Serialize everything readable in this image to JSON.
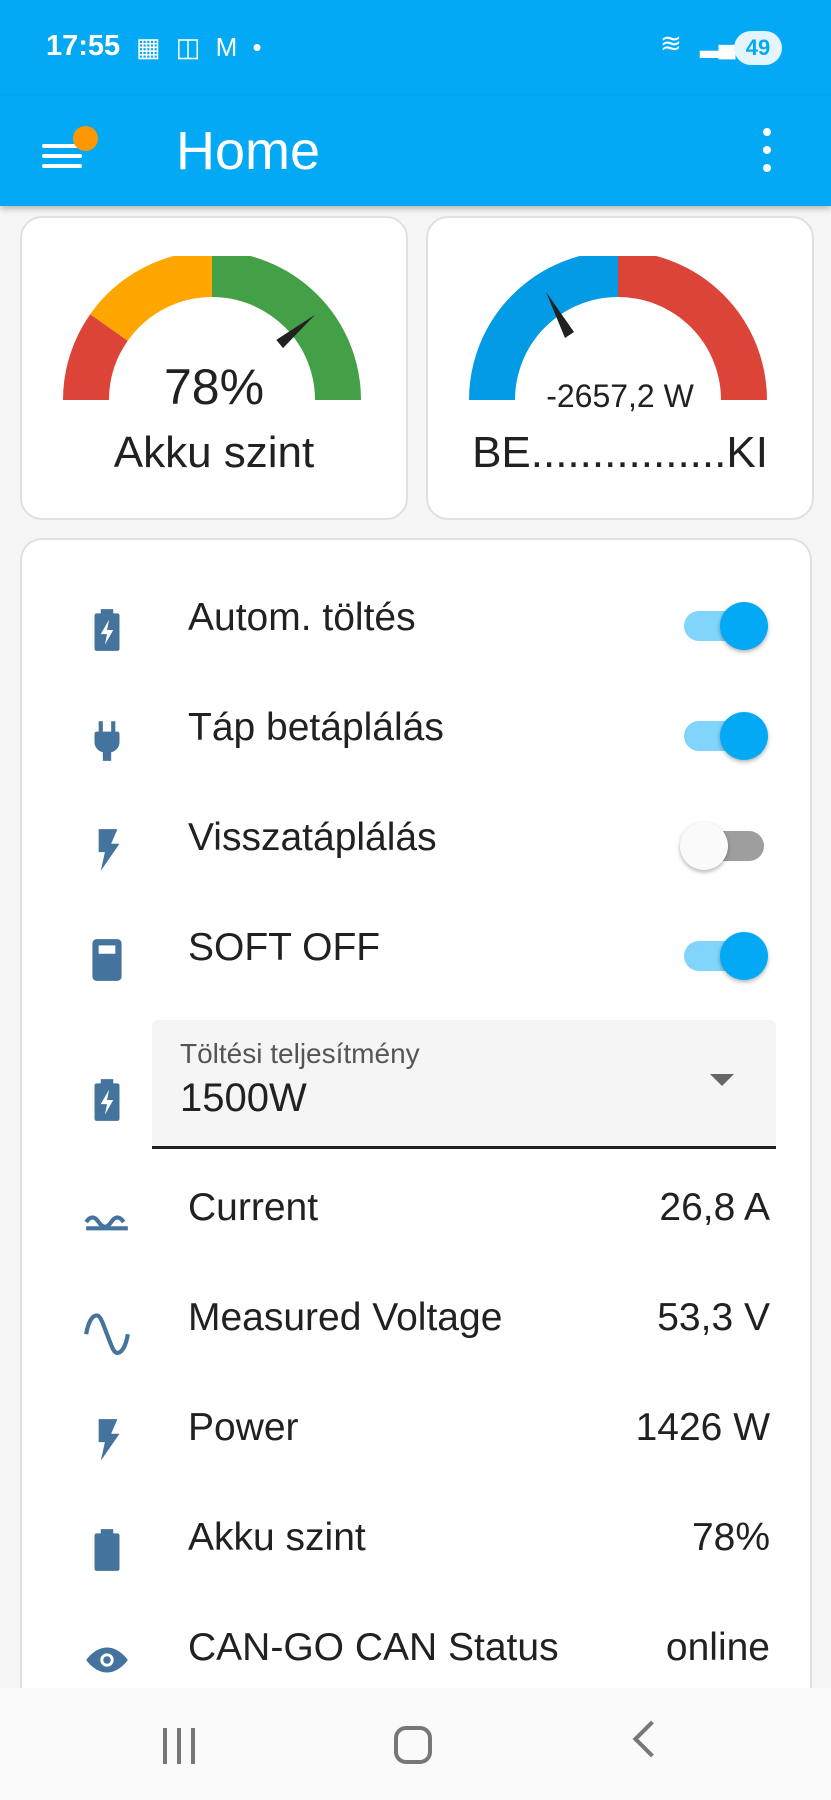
{
  "status_bar": {
    "time": "17:55",
    "battery": "49"
  },
  "app_bar": {
    "title": "Home"
  },
  "gauges": [
    {
      "value": "78%",
      "name": "Akku szint",
      "level_percent": 78
    },
    {
      "value": "-2657,2 W",
      "name": "BE................KI"
    }
  ],
  "toggles": [
    {
      "label": "Autom. töltés",
      "state": "on",
      "icon": "battery-charging-icon"
    },
    {
      "label": "Táp betáplálás",
      "state": "on",
      "icon": "power-plug-icon"
    },
    {
      "label": "Visszatáplálás",
      "state": "off",
      "icon": "lightning-bolt-icon"
    },
    {
      "label": "SOFT OFF",
      "state": "on",
      "icon": "battery-box-icon"
    }
  ],
  "select": {
    "label": "Töltési teljesítmény",
    "value": "1500W",
    "icon": "battery-charging-icon"
  },
  "sensors": [
    {
      "label": "Current",
      "value": "26,8 A",
      "icon": "current-ac-icon"
    },
    {
      "label": "Measured Voltage",
      "value": "53,3 V",
      "icon": "sine-wave-icon"
    },
    {
      "label": "Power",
      "value": "1426 W",
      "icon": "lightning-bolt-icon"
    },
    {
      "label": "Akku szint",
      "value": "78%",
      "icon": "battery-icon"
    },
    {
      "label": "CAN-GO CAN Status",
      "value": "online",
      "icon": "eye-icon"
    }
  ],
  "colors": {
    "primary": "#03a9f4",
    "icon": "#44739e",
    "gauge_red": "#db4437",
    "gauge_orange": "#ffa600",
    "gauge_green": "#43a047",
    "gauge_blue": "#039be5"
  }
}
